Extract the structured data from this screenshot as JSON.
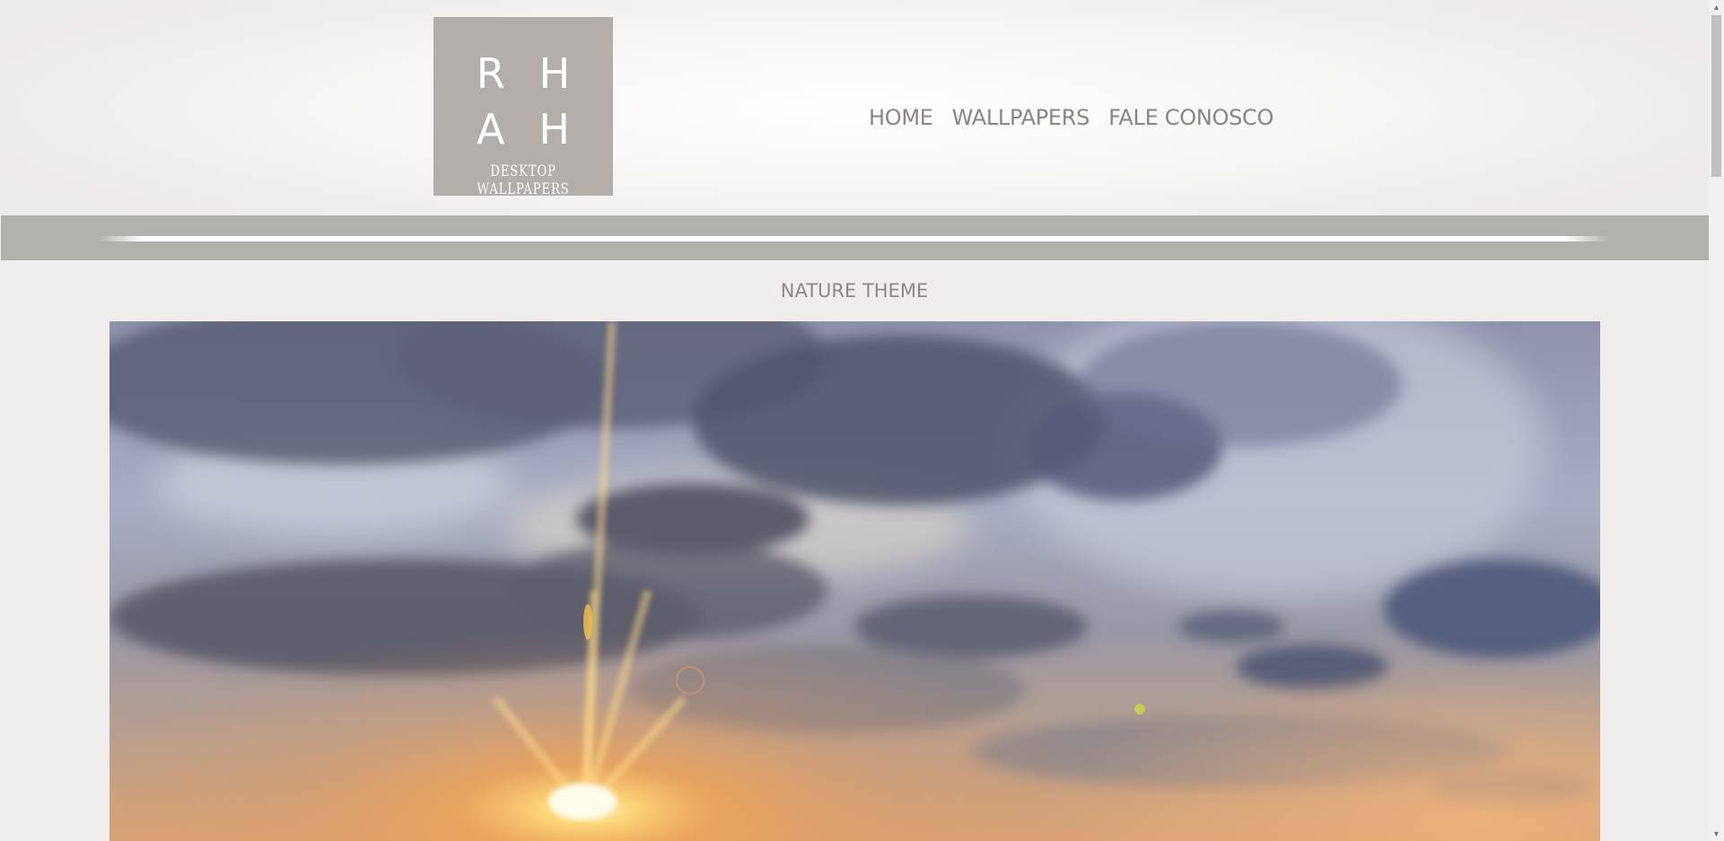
{
  "logo": {
    "row1": "RH",
    "row2": "AH",
    "subtitle": "DESKTOP WALLPAPERS"
  },
  "nav": {
    "items": [
      {
        "label": "HOME"
      },
      {
        "label": "WALLPAPERS"
      },
      {
        "label": "FALE CONOSCO"
      }
    ]
  },
  "section": {
    "title": "NATURE THEME"
  },
  "colors": {
    "background": "#f2eded",
    "logo_bg": "#b3aeaa",
    "band": "#b4b0ac",
    "nav_text": "#8b8480"
  },
  "icons": {
    "scroll_up": "triangle-up",
    "scroll_down": "triangle-down"
  }
}
